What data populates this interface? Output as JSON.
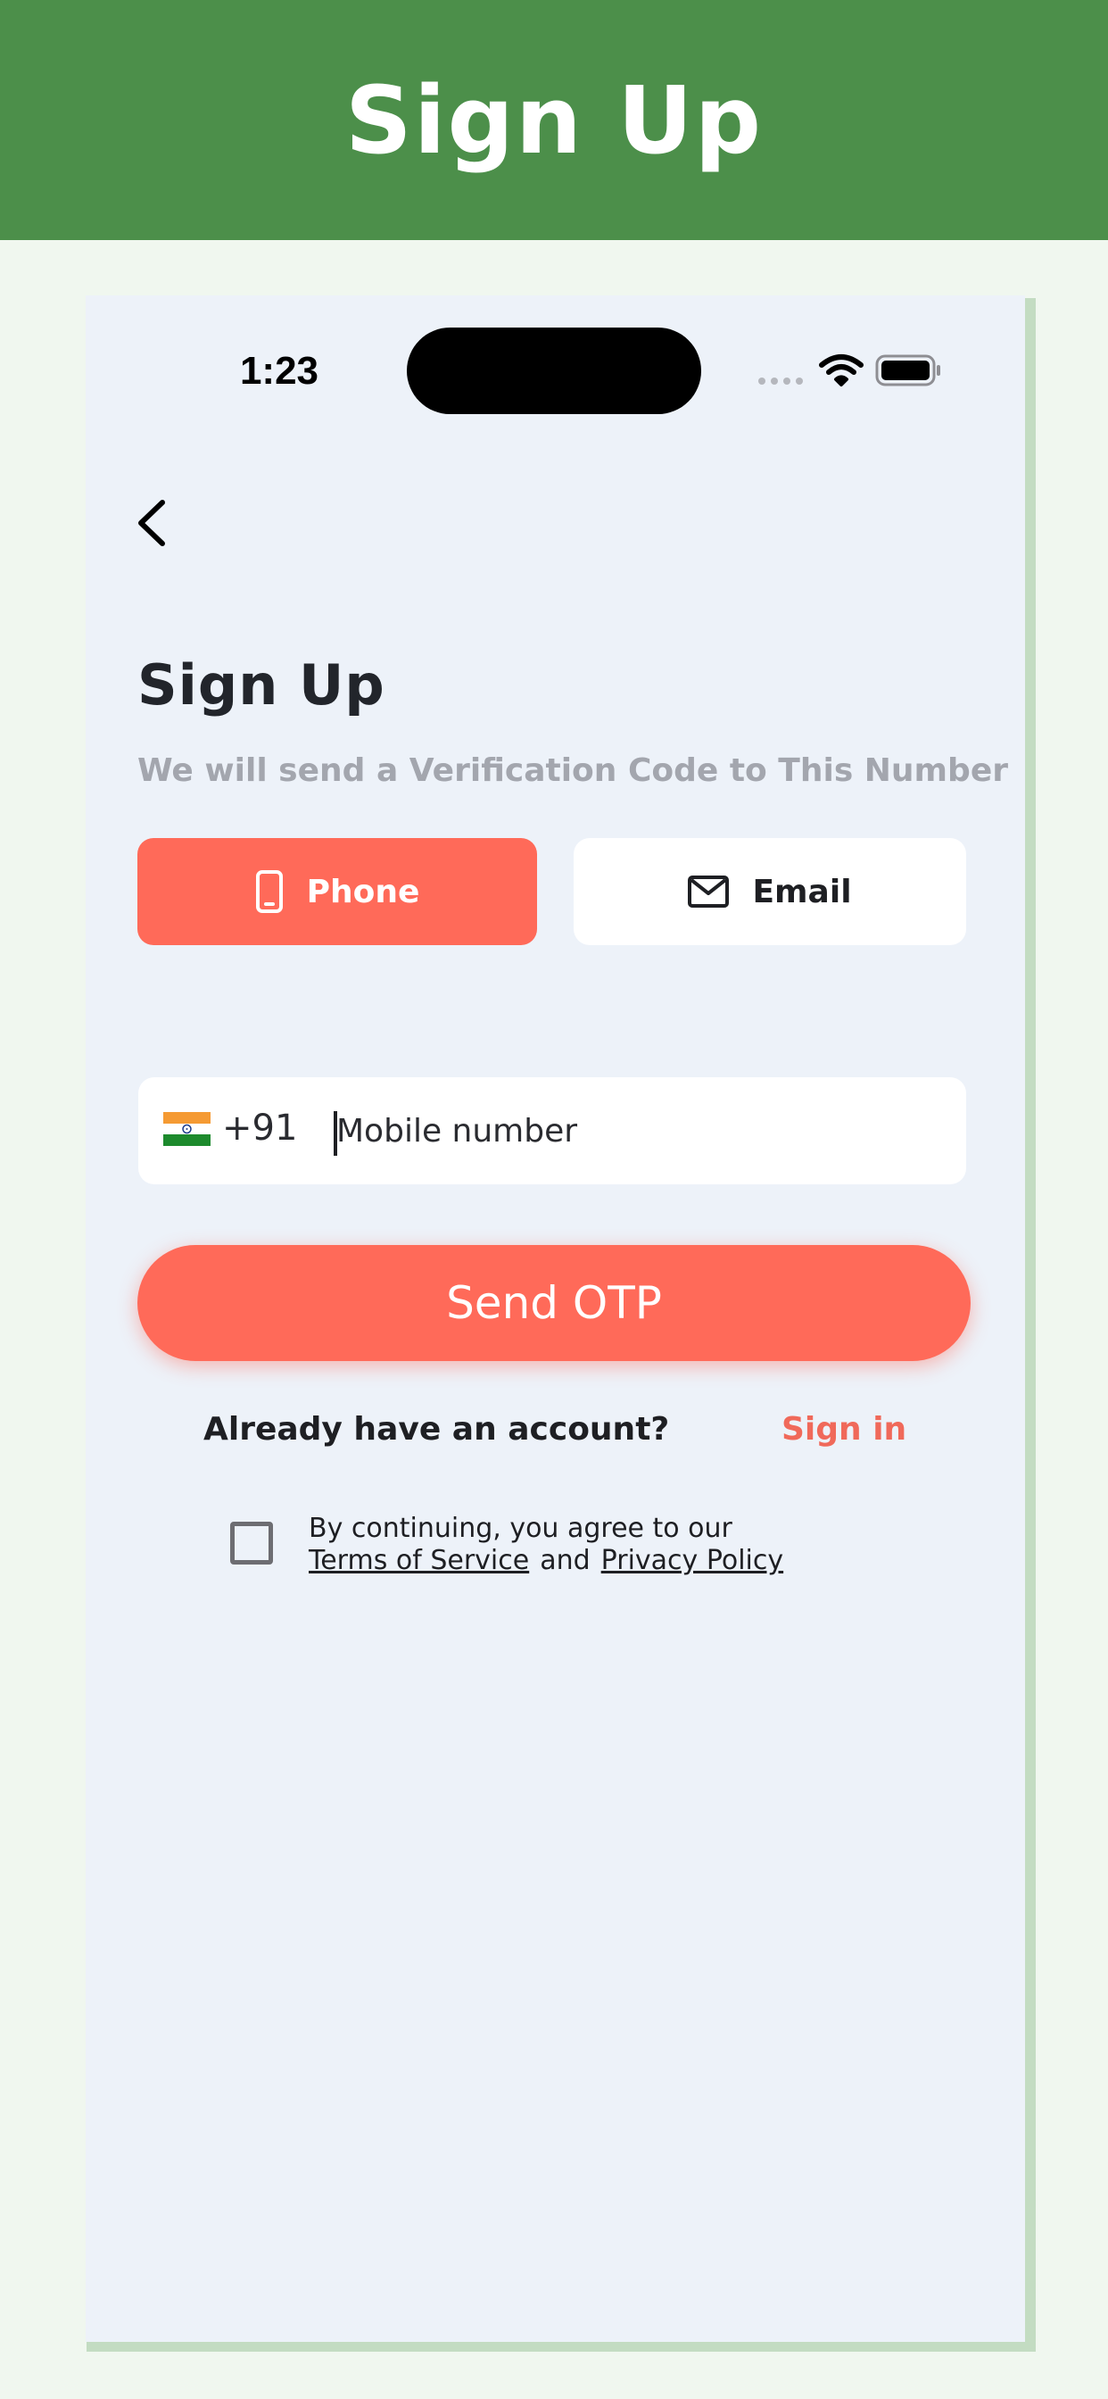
{
  "banner": {
    "title": "Sign Up"
  },
  "status_bar": {
    "time": "1:23"
  },
  "screen": {
    "title": "Sign Up",
    "subtitle": "We will send a Verification Code to This Number"
  },
  "tabs": [
    {
      "label": "Phone",
      "icon": "phone-icon",
      "selected": true
    },
    {
      "label": "Email",
      "icon": "mail-icon",
      "selected": false
    }
  ],
  "phone_input": {
    "country_code": "+91",
    "flag": "india-flag-icon",
    "value": "",
    "placeholder": "Mobile number"
  },
  "send_button": {
    "label": "Send OTP"
  },
  "signin": {
    "prompt": "Already have an account?",
    "link": "Sign in"
  },
  "terms": {
    "line1": "By continuing, you agree to our",
    "terms_link": "Terms of Service",
    "and": "and",
    "privacy_link": "Privacy Policy",
    "checked": false
  },
  "colors": {
    "banner": "#4c8f4a",
    "accent": "#ff6a59",
    "screen_bg": "#edf2f9",
    "link": "#f0695a"
  }
}
